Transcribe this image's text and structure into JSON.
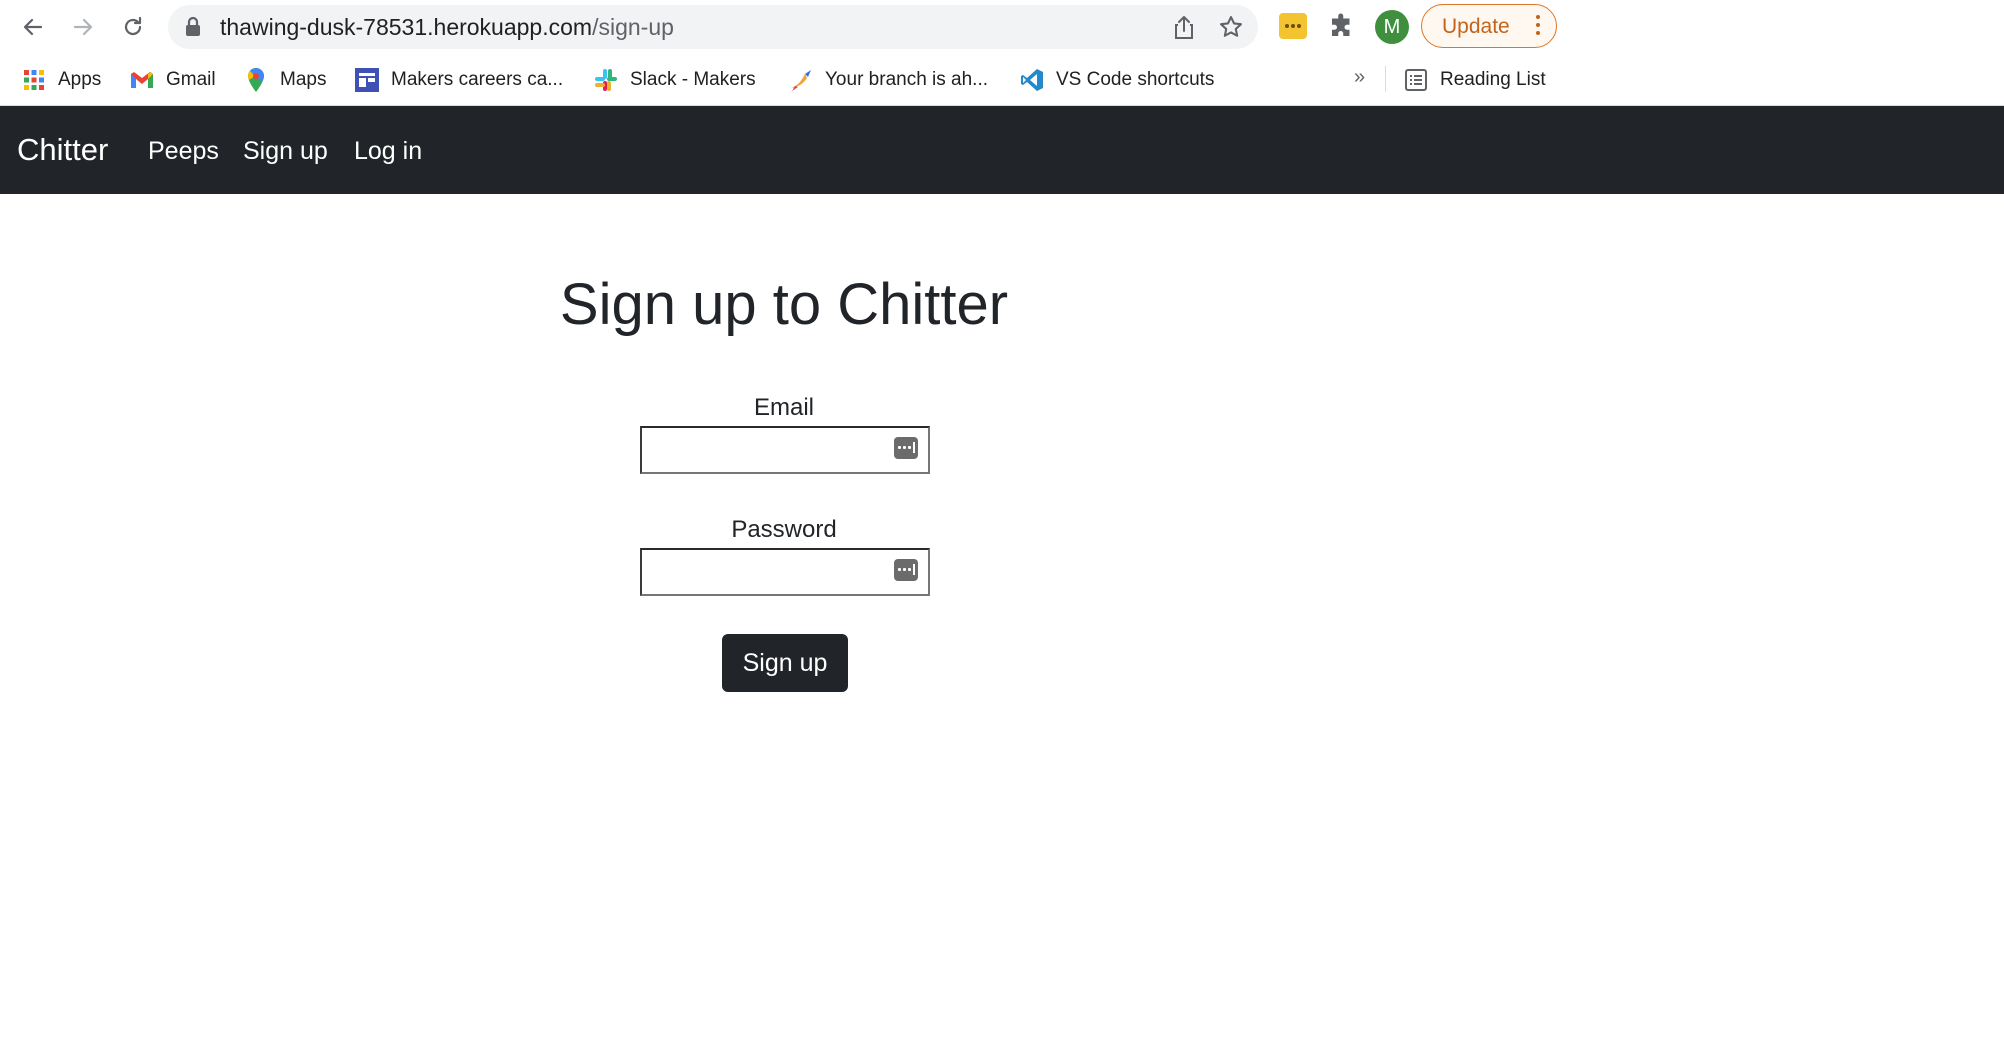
{
  "browser": {
    "url_host": "thawing-dusk-78531.herokuapp.com",
    "url_path": "/sign-up",
    "profile_initial": "M",
    "update_label": "Update"
  },
  "bookmarks": {
    "items": [
      {
        "label": "Apps",
        "icon": "apps-grid-icon"
      },
      {
        "label": "Gmail",
        "icon": "gmail-icon"
      },
      {
        "label": "Maps",
        "icon": "maps-pin-icon"
      },
      {
        "label": "Makers careers ca...",
        "icon": "makers-board-icon"
      },
      {
        "label": "Slack - Makers",
        "icon": "slack-icon"
      },
      {
        "label": "Your branch is ah...",
        "icon": "bird-icon"
      },
      {
        "label": "VS Code shortcuts",
        "icon": "vscode-icon"
      }
    ],
    "more": "»",
    "reading_list": "Reading List"
  },
  "navbar": {
    "brand": "Chitter",
    "links": [
      "Peeps",
      "Sign up",
      "Log in"
    ],
    "background": "#212529"
  },
  "form": {
    "title": "Sign up to Chitter",
    "email_label": "Email",
    "email_value": "",
    "password_label": "Password",
    "password_value": "",
    "submit_label": "Sign up"
  }
}
